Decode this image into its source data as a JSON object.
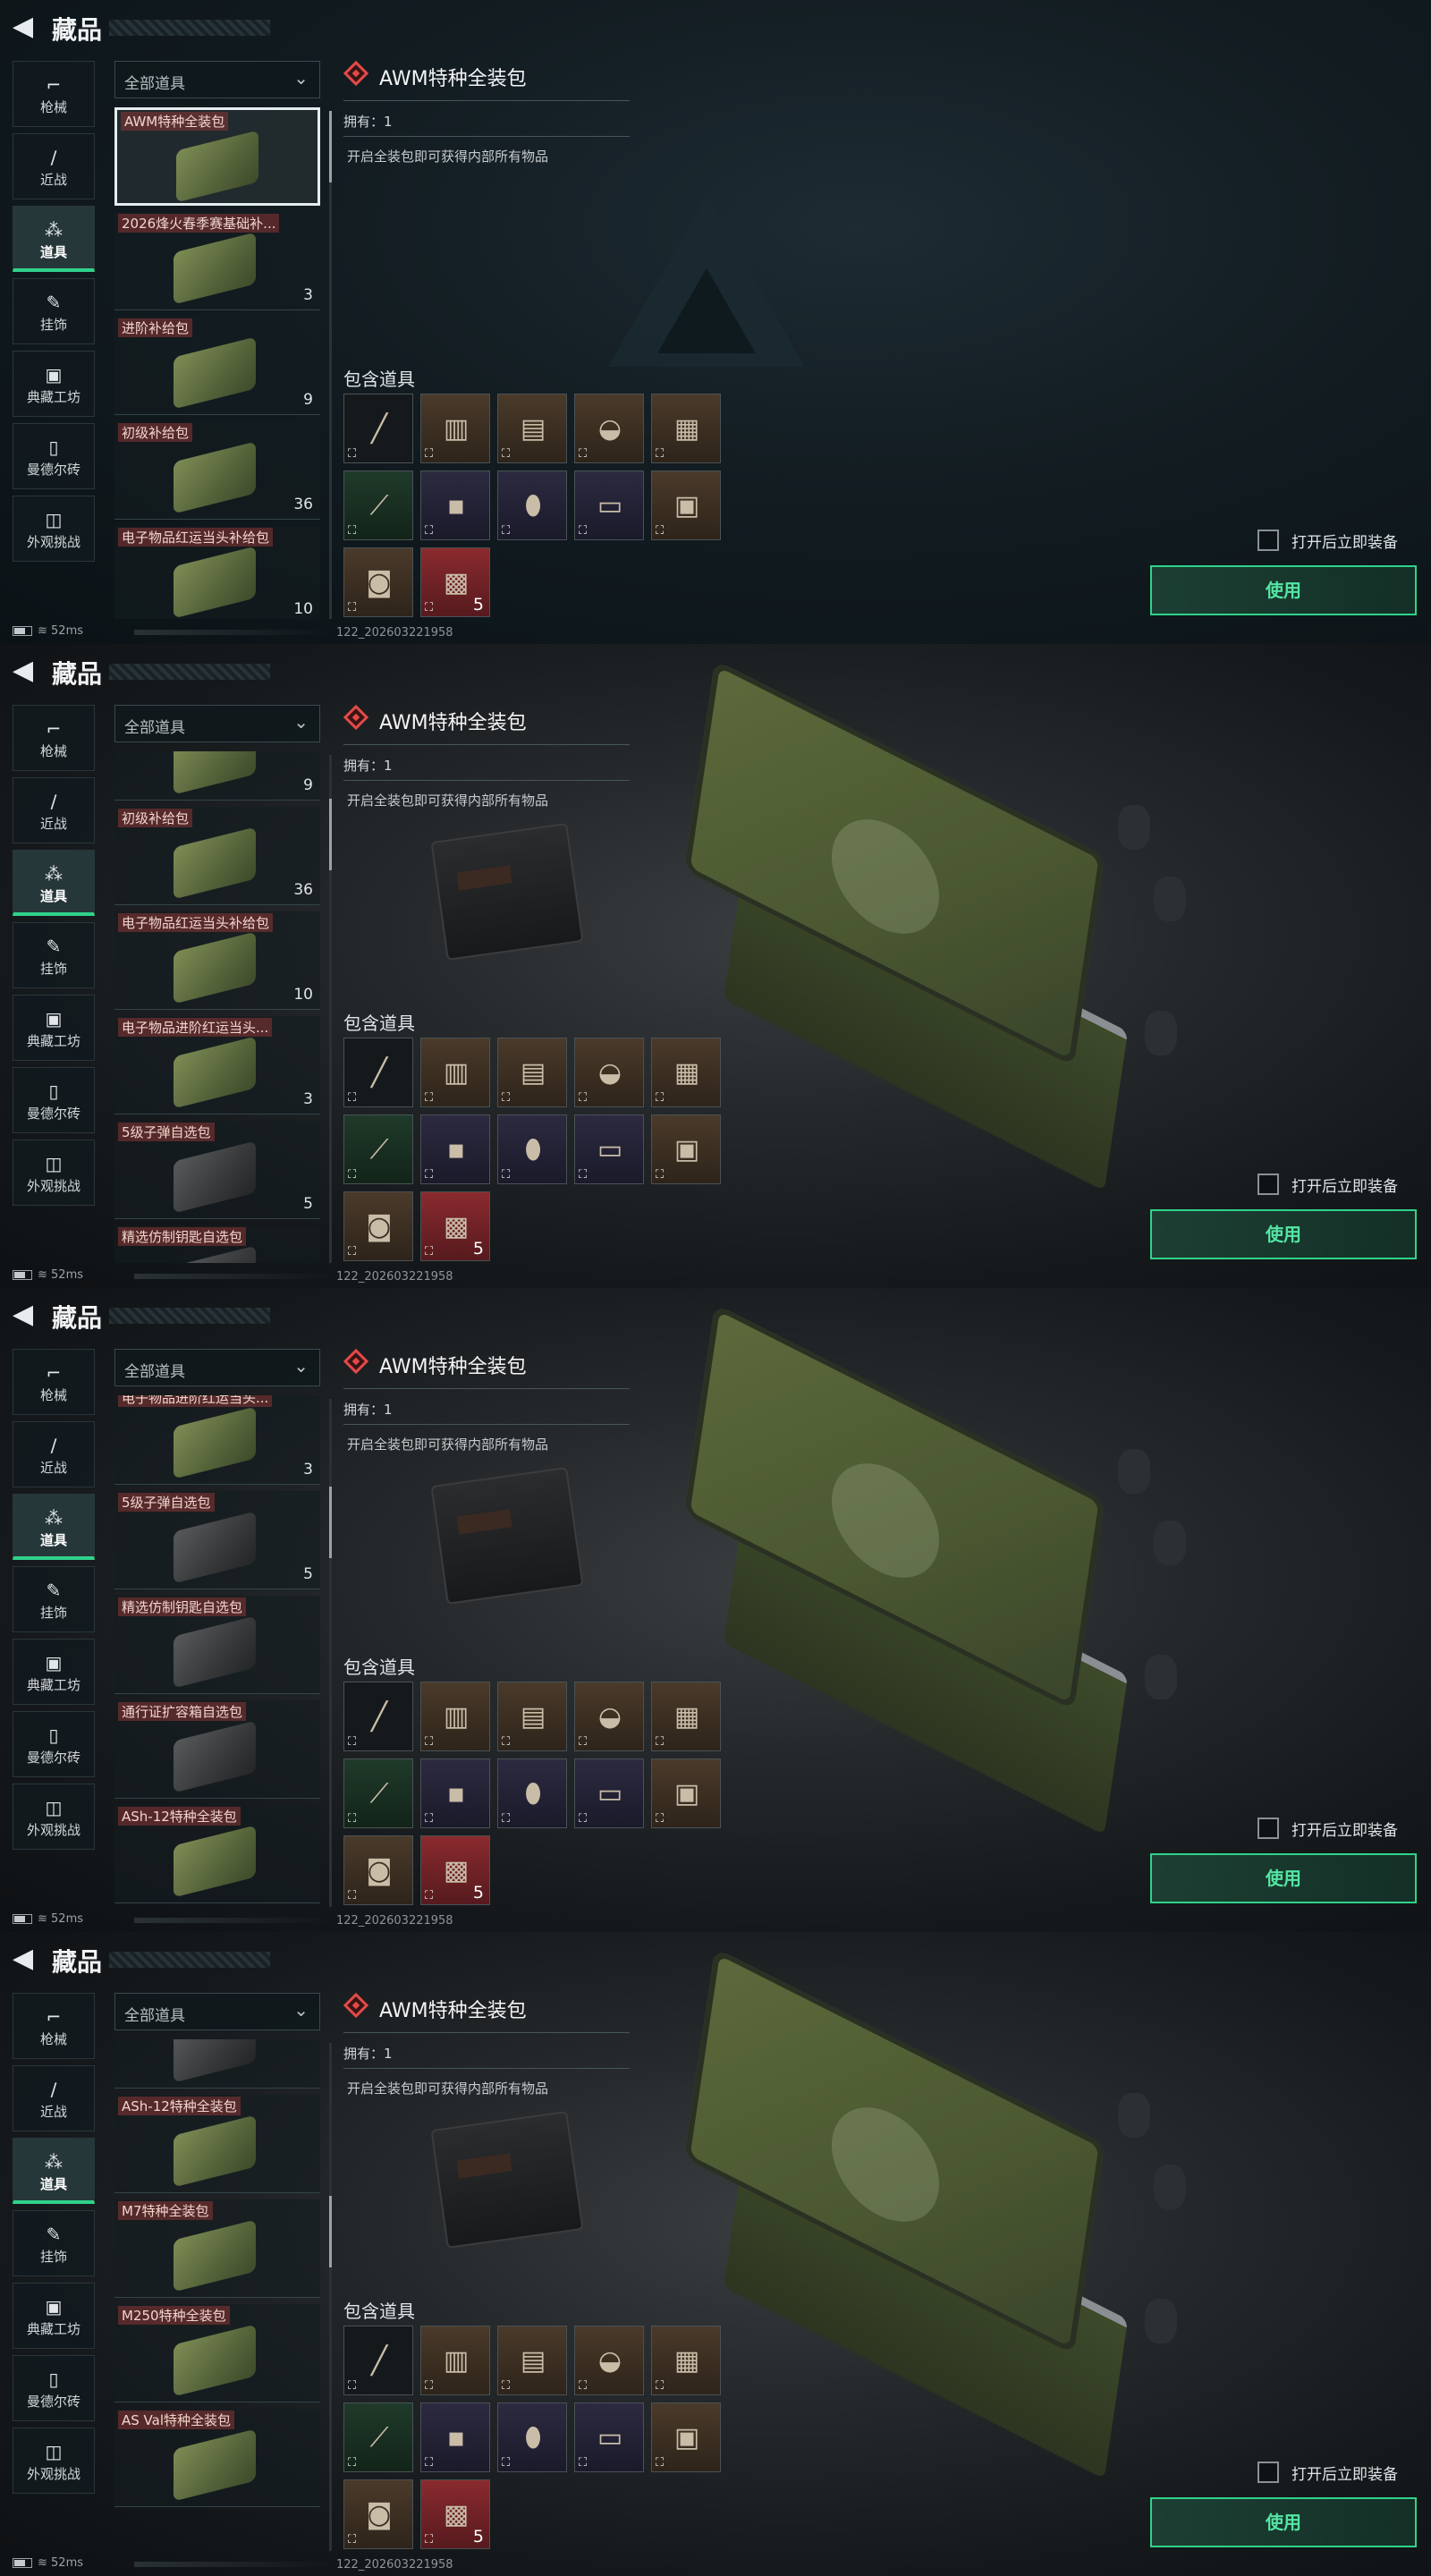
{
  "header": {
    "title": "藏品"
  },
  "categories": [
    {
      "label": "枪械",
      "icon": "gun-icon"
    },
    {
      "label": "近战",
      "icon": "knife-icon"
    },
    {
      "label": "道具",
      "icon": "items-icon"
    },
    {
      "label": "挂饰",
      "icon": "charm-icon"
    },
    {
      "label": "典藏工坊",
      "icon": "workshop-icon"
    },
    {
      "label": "曼德尔砖",
      "icon": "mandel-brick-icon"
    },
    {
      "label": "外观挑战",
      "icon": "appearance-challenge-icon"
    }
  ],
  "active_category": "道具",
  "filter": {
    "value": "全部道具"
  },
  "items": [
    {
      "name": "AWM特种全装包",
      "qty": "",
      "style": "green"
    },
    {
      "name": "2026烽火春季赛基础补...",
      "qty": "3",
      "style": "green"
    },
    {
      "name": "进阶补给包",
      "qty": "9",
      "style": "green"
    },
    {
      "name": "初级补给包",
      "qty": "36",
      "style": "green"
    },
    {
      "name": "电子物品红运当头补给包",
      "qty": "10",
      "style": "green"
    },
    {
      "name": "电子物品进阶红运当头...",
      "qty": "3",
      "style": "green"
    },
    {
      "name": "5级子弹自选包",
      "qty": "5",
      "style": "dark"
    },
    {
      "name": "精选仿制钥匙自选包",
      "qty": "",
      "style": "dark"
    },
    {
      "name": "通行证扩容箱自选包",
      "qty": "",
      "style": "dark"
    },
    {
      "name": "ASh-12特种全装包",
      "qty": "",
      "style": "green"
    },
    {
      "name": "M7特种全装包",
      "qty": "",
      "style": "green"
    },
    {
      "name": "M250特种全装包",
      "qty": "",
      "style": "green"
    },
    {
      "name": "AS Val特种全装包",
      "qty": "",
      "style": "green"
    }
  ],
  "detail": {
    "title": "AWM特种全装包",
    "owned": "拥有：1",
    "description": "开启全装包即可获得内部所有物品",
    "contains_label": "包含道具",
    "slots": [
      {
        "icon": "sniper-rifle-icon",
        "bg": "blk",
        "qty": ""
      },
      {
        "icon": "backpack-icon",
        "bg": "brn",
        "qty": ""
      },
      {
        "icon": "chest-rig-icon",
        "bg": "brn",
        "qty": ""
      },
      {
        "icon": "helmet-icon",
        "bg": "brn",
        "qty": ""
      },
      {
        "icon": "body-armor-icon",
        "bg": "brn",
        "qty": ""
      },
      {
        "icon": "syringe-icon",
        "bg": "grn",
        "qty": ""
      },
      {
        "icon": "ammo-box-icon",
        "bg": "pur",
        "qty": ""
      },
      {
        "icon": "injector-icon",
        "bg": "pur",
        "qty": ""
      },
      {
        "icon": "access-card-icon",
        "bg": "pur",
        "qty": ""
      },
      {
        "icon": "medkit-icon",
        "bg": "brn",
        "qty": ""
      },
      {
        "icon": "toolbox-icon",
        "bg": "brn",
        "qty": ""
      },
      {
        "icon": "ammo-crate-icon",
        "bg": "red",
        "qty": "5"
      }
    ]
  },
  "auto_equip_label": "打开后立即装备",
  "use_button": "使用",
  "status": {
    "ping": "52ms",
    "version": "122_202603221958"
  },
  "screens": [
    {
      "first_item": 0,
      "offset": 0,
      "scroll_fraction": 0.0
    },
    {
      "first_item": 2,
      "offset": 55,
      "scroll_fraction": 0.1
    },
    {
      "first_item": 5,
      "offset": 10,
      "scroll_fraction": 0.2
    },
    {
      "first_item": 8,
      "offset": 55,
      "scroll_fraction": 0.35
    }
  ],
  "colors": {
    "accent": "#2fd38a",
    "danger": "#e24a4a",
    "tag": "#8c3434"
  }
}
